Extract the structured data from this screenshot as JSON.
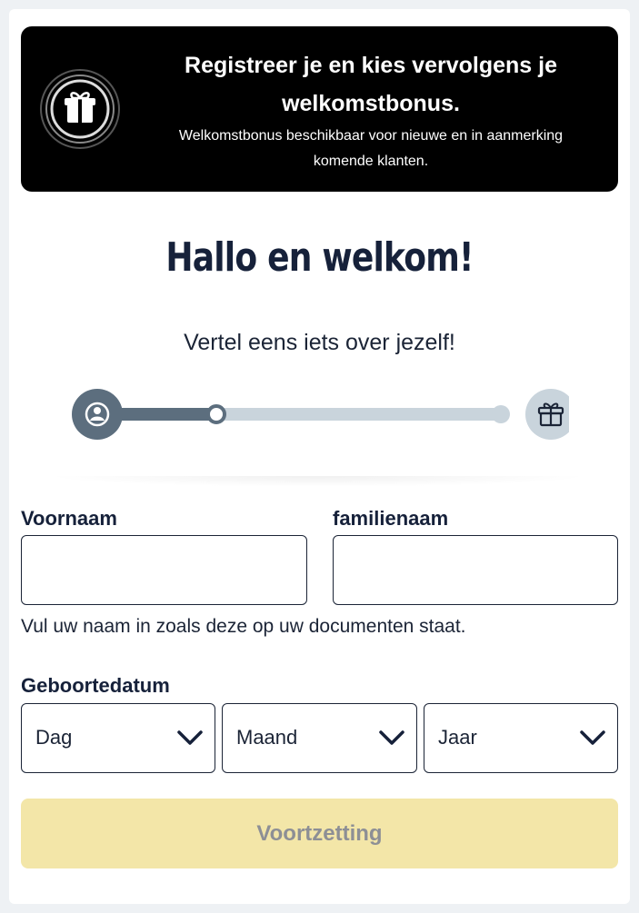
{
  "banner": {
    "icon": "gift-icon",
    "title_line1": "Registreer je en kies vervolgens je",
    "title_line2": "welkomstbonus.",
    "subtitle_line1": "Welkomstbonus beschikbaar voor nieuwe en in aanmerking",
    "subtitle_line2": "komende klanten."
  },
  "heading": "Hallo en welkom!",
  "subheading": "Vertel eens iets over jezelf!",
  "progress": {
    "start_icon": "user-icon",
    "end_icon": "gift-icon",
    "current_step_fraction": 0.25,
    "active_color": "#5c6e7e",
    "inactive_color": "#c9d4dc"
  },
  "form": {
    "first_name": {
      "label": "Voornaam",
      "value": "",
      "placeholder": ""
    },
    "last_name": {
      "label": "familienaam",
      "value": "",
      "placeholder": ""
    },
    "name_hint": "Vul uw naam in zoals deze op uw documenten staat.",
    "birthdate": {
      "label": "Geboortedatum",
      "day": "Dag",
      "month": "Maand",
      "year": "Jaar"
    },
    "submit_label": "Voortzetting"
  },
  "colors": {
    "banner_bg": "#000000",
    "submit_bg": "#f3e6a8",
    "submit_text": "#8d8f95",
    "text": "#1b2436"
  }
}
